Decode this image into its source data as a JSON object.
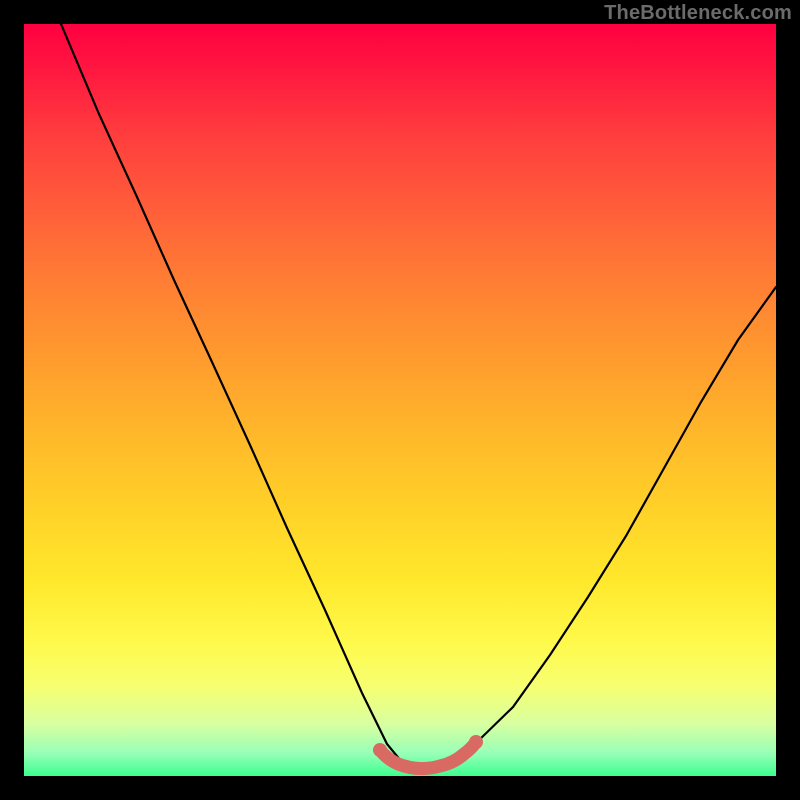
{
  "watermark": "TheBottleneck.com",
  "chart_data": {
    "type": "line",
    "title": "",
    "xlabel": "",
    "ylabel": "",
    "xlim": [
      0,
      100
    ],
    "ylim": [
      0,
      100
    ],
    "series": [
      {
        "name": "bottleneck-curve",
        "x": [
          5,
          10,
          15,
          20,
          25,
          30,
          35,
          40,
          45,
          48,
          50,
          52,
          55,
          57,
          60,
          65,
          70,
          75,
          80,
          85,
          90,
          95,
          100
        ],
        "y": [
          100,
          88,
          77,
          66,
          55,
          44,
          33,
          22,
          11,
          4,
          1,
          0,
          0,
          0,
          3,
          9,
          16,
          24,
          32,
          41,
          50,
          58,
          65
        ]
      },
      {
        "name": "flat-ideal-band",
        "x": [
          48,
          50,
          52,
          55,
          57
        ],
        "y": [
          3,
          1.5,
          1,
          1.5,
          3
        ]
      }
    ],
    "gradient_colors": {
      "top": "#ff0040",
      "mid": "#ffe82c",
      "bottom": "#3cff8e"
    },
    "highlight_color": "#d86a63"
  }
}
